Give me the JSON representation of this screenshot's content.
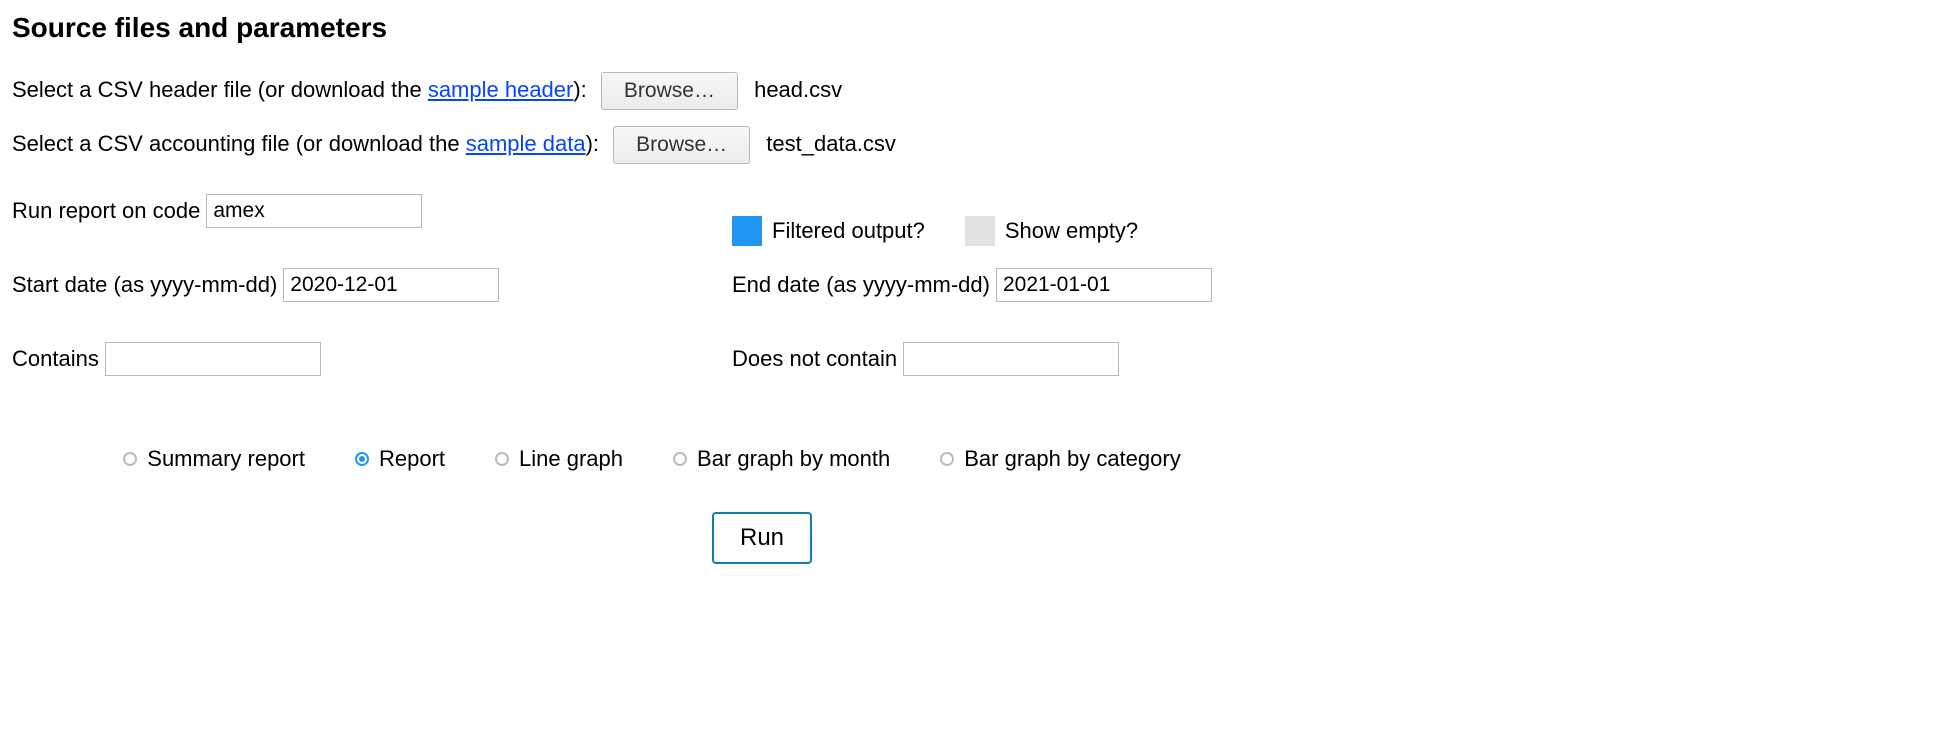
{
  "heading": "Source files and parameters",
  "header_row": {
    "pre": "Select a CSV header file (or download the ",
    "link": "sample header",
    "post": "): ",
    "browse": "Browse…",
    "filename": "head.csv"
  },
  "data_row": {
    "pre": "Select a CSV accounting file (or download the ",
    "link": "sample data",
    "post": "): ",
    "browse": "Browse…",
    "filename": "test_data.csv"
  },
  "code": {
    "label": "Run report on code",
    "value": "amex"
  },
  "filtered": {
    "label": "Filtered output?"
  },
  "show_empty": {
    "label": "Show empty?"
  },
  "start_date": {
    "label": "Start date (as yyyy-mm-dd)",
    "value": "2020-12-01"
  },
  "end_date": {
    "label": "End date (as yyyy-mm-dd)",
    "value": "2021-01-01"
  },
  "contains": {
    "label": "Contains",
    "value": ""
  },
  "not_contains": {
    "label": "Does not contain",
    "value": ""
  },
  "report_types": {
    "summary": "Summary report",
    "report": "Report",
    "line": "Line graph",
    "bar_month": "Bar graph by month",
    "bar_cat": "Bar graph by category"
  },
  "run": "Run"
}
